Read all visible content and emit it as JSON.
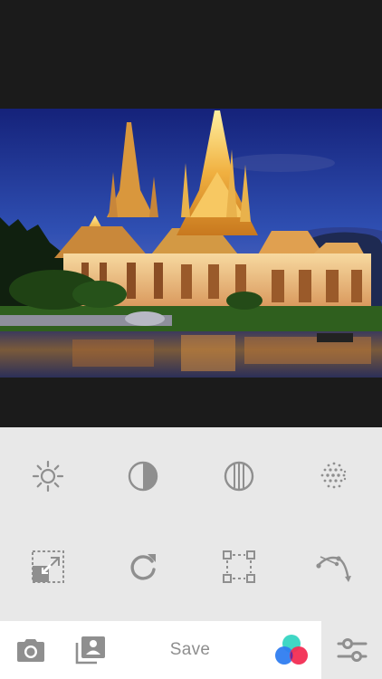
{
  "editor": {
    "photo": {
      "subject": "temple-photo"
    },
    "tools": [
      {
        "name": "brightness-tool",
        "icon": "sun-icon"
      },
      {
        "name": "contrast-tool",
        "icon": "half-circle-icon"
      },
      {
        "name": "saturation-tool",
        "icon": "striped-circle-icon"
      },
      {
        "name": "vignette-tool",
        "icon": "dotted-circle-icon"
      },
      {
        "name": "crop-tool",
        "icon": "crop-expand-icon"
      },
      {
        "name": "rotate-tool",
        "icon": "rotate-icon"
      },
      {
        "name": "transform-tool",
        "icon": "transform-corners-icon"
      },
      {
        "name": "curves-tool",
        "icon": "curve-path-icon"
      }
    ],
    "toolbar": {
      "save_label": "Save",
      "camera_icon": "camera-icon",
      "library_icon": "photo-library-icon",
      "filters_icon": "color-filters-icon",
      "adjust_icon": "sliders-icon"
    },
    "colors": {
      "icon_gray": "#8f8f8f",
      "panel_bg": "#e8e8e8",
      "toolbar_bg": "#ffffff",
      "dark_bg": "#1b1b1b"
    }
  }
}
